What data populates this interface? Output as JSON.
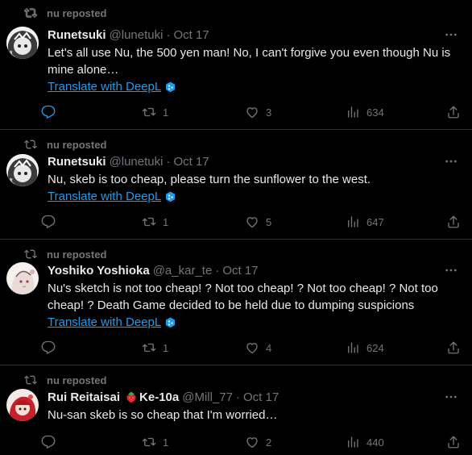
{
  "tweets": [
    {
      "repost_label": "nu reposted",
      "name": "Runetsuki",
      "handle": "@lunetuki",
      "time": "Oct 17",
      "text": "Let's all use Nu, the 500 yen man! No, I can't forgive you even though Nu is mine alone…",
      "translate": "Translate with DeepL",
      "replies": "",
      "reposts": "1",
      "likes": "3",
      "views": "634"
    },
    {
      "repost_label": "nu reposted",
      "name": "Runetsuki",
      "handle": "@lunetuki",
      "time": "Oct 17",
      "text": "Nu, skeb is too cheap, please turn the sunflower to the west.",
      "translate": "Translate with DeepL",
      "replies": "",
      "reposts": "1",
      "likes": "5",
      "views": "647"
    },
    {
      "repost_label": "nu reposted",
      "name": "Yoshiko Yoshioka",
      "handle": "@a_kar_te",
      "time": "Oct 17",
      "text": "Nu's sketch is not too cheap! ? Not too cheap! ? Not too cheap! ? Not too cheap! ? Death Game decided to be held due to dumping suspicions",
      "translate": "Translate with DeepL",
      "replies": "",
      "reposts": "1",
      "likes": "4",
      "views": "624"
    },
    {
      "repost_label": "nu reposted",
      "name": "Rui Reitaisai",
      "name_suffix": "Ke-10a",
      "handle": "@Mill_77",
      "time": "Oct 17",
      "text": "Nu-san skeb is so cheap that I'm worried…",
      "replies": "",
      "reposts": "1",
      "likes": "2",
      "views": "440"
    }
  ],
  "colors": {
    "background": "#000000",
    "text": "#e7e9ea",
    "muted": "#71767b",
    "link": "#1d9bf0",
    "divider": "#2f3336"
  },
  "icons": [
    "repost-icon",
    "more-icon",
    "reply-icon",
    "like-icon",
    "views-icon",
    "share-icon",
    "deepl-icon",
    "strawberry-icon"
  ]
}
